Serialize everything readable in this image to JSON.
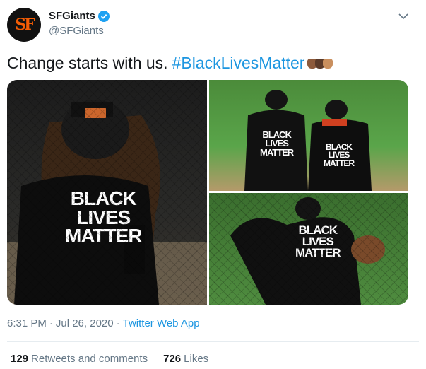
{
  "tweet": {
    "display_name": "SFGiants",
    "handle": "@SFGiants",
    "avatar_text": "SF",
    "text": "Change starts with us.",
    "hashtag": "#BlackLivesMatter",
    "shirt_line1": "BLACK",
    "shirt_line2": "LIVES",
    "shirt_line3": "MATTER",
    "time": "6:31 PM",
    "separator1": "·",
    "date": "Jul 26, 2020",
    "separator2": "·",
    "source": "Twitter Web App",
    "retweets_count": "129",
    "retweets_label": "Retweets and comments",
    "likes_count": "726",
    "likes_label": "Likes"
  },
  "colors": {
    "link": "#1b95e0",
    "verified": "#1da1f2",
    "secondary_text": "#657786",
    "giants_orange": "#f25c05"
  }
}
